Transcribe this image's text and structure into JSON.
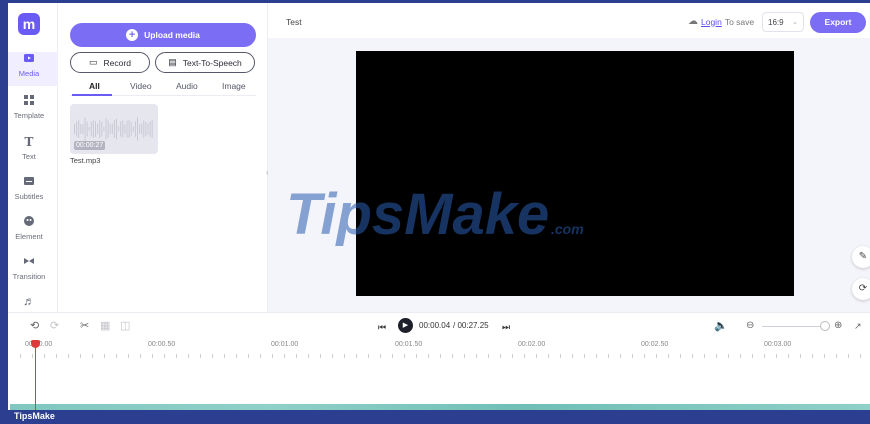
{
  "app": {
    "logo_text": "m",
    "brand_color": "#7b6ef5"
  },
  "sidebar": {
    "items": [
      {
        "label": "Media",
        "icon": "media-icon"
      },
      {
        "label": "Template",
        "icon": "template-icon"
      },
      {
        "label": "Text",
        "icon": "text-icon"
      },
      {
        "label": "Subtitles",
        "icon": "subtitles-icon"
      },
      {
        "label": "Element",
        "icon": "element-icon"
      },
      {
        "label": "Transition",
        "icon": "transition-icon"
      },
      {
        "label": "",
        "icon": "music-icon"
      }
    ]
  },
  "media_panel": {
    "upload_label": "Upload media",
    "record_label": "Record",
    "tts_label": "Text-To-Speech",
    "tabs": [
      "All",
      "Video",
      "Audio",
      "Image"
    ],
    "items": [
      {
        "name": "Test.mp3",
        "duration": "00:00:27"
      }
    ]
  },
  "header": {
    "project_title": "Test",
    "login_label": "Login",
    "save_hint": "To save",
    "aspect_ratio": "16:9",
    "export_label": "Export"
  },
  "watermark": {
    "text": "TipsMake",
    "suffix": ".com"
  },
  "playback": {
    "current_time": "00:00.04",
    "total_time": "/ 00:27.25"
  },
  "timeline": {
    "ruler_labels": [
      "00:00.00",
      "00:00.50",
      "00:01.00",
      "00:01.50",
      "00:02.00",
      "00:02.50",
      "00:03.00"
    ]
  },
  "footer": {
    "brand": "TipsMake"
  }
}
